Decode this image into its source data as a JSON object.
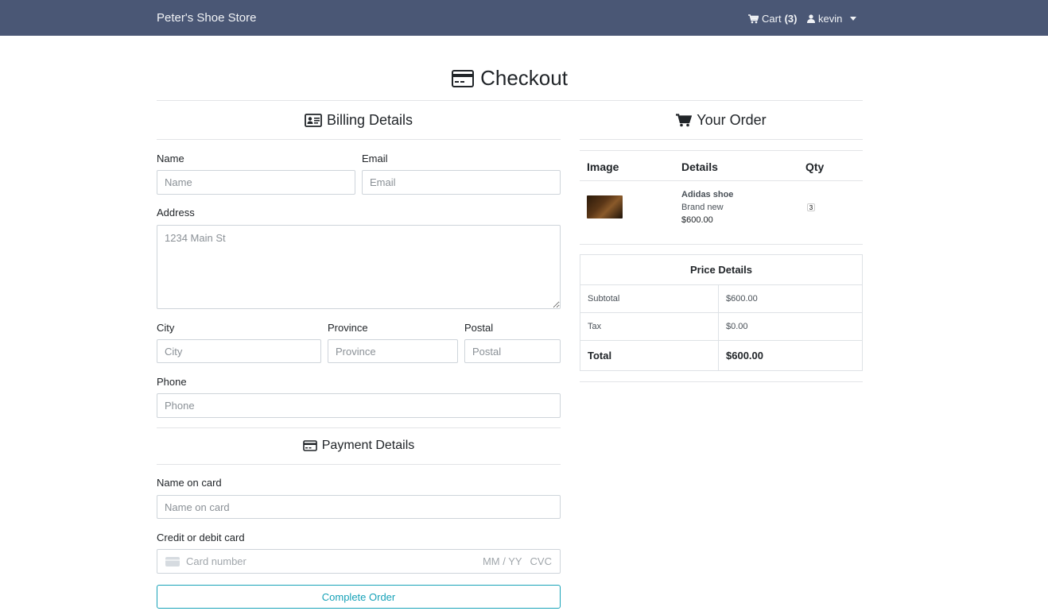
{
  "navbar": {
    "brand": "Peter's Shoe Store",
    "cart_label": "Cart",
    "cart_count": "(3)",
    "user_name": "kevin"
  },
  "page": {
    "title": "Checkout"
  },
  "billing": {
    "title": "Billing Details",
    "name_label": "Name",
    "name_placeholder": "Name",
    "email_label": "Email",
    "email_placeholder": "Email",
    "address_label": "Address",
    "address_placeholder": "1234 Main St",
    "city_label": "City",
    "city_placeholder": "City",
    "province_label": "Province",
    "province_placeholder": "Province",
    "postal_label": "Postal",
    "postal_placeholder": "Postal",
    "phone_label": "Phone",
    "phone_placeholder": "Phone"
  },
  "payment": {
    "title": "Payment Details",
    "name_on_card_label": "Name on card",
    "name_on_card_placeholder": "Name on card",
    "card_label": "Credit or debit card",
    "card_number_placeholder": "Card number",
    "card_exp_placeholder": "MM / YY",
    "card_cvc_placeholder": "CVC",
    "complete_button": "Complete Order"
  },
  "order": {
    "title": "Your Order",
    "columns": [
      "Image",
      "Details",
      "Qty"
    ],
    "items": [
      {
        "name": "Adidas shoe",
        "condition": "Brand new",
        "price": "$600.00",
        "qty": "3"
      }
    ]
  },
  "price_details": {
    "title": "Price Details",
    "rows": [
      {
        "label": "Subtotal",
        "value": "$600.00"
      },
      {
        "label": "Tax",
        "value": "$0.00"
      },
      {
        "label": "Total",
        "value": "$600.00"
      }
    ]
  },
  "colors": {
    "navbar_bg": "#4a5775",
    "accent": "#17a2b8"
  }
}
